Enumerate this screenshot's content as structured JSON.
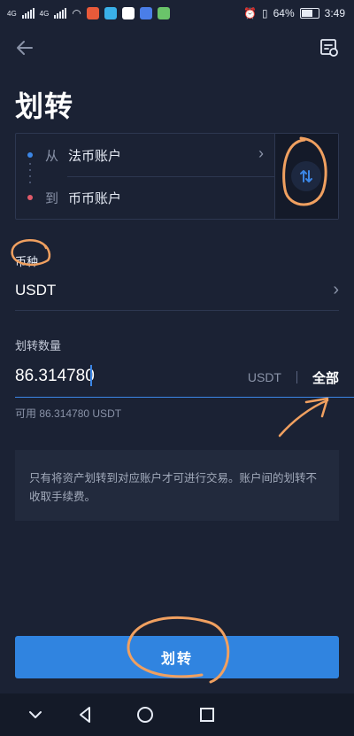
{
  "status_bar": {
    "network_left": "4G",
    "network_right": "4G",
    "battery": "64%",
    "time": "3:49"
  },
  "page": {
    "title": "划转"
  },
  "accounts": {
    "from_key": "从",
    "from_account": "法币账户",
    "to_key": "到",
    "to_account": "币币账户"
  },
  "coin": {
    "label": "币种",
    "value": "USDT"
  },
  "amount": {
    "label": "划转数量",
    "value": "86.314780",
    "unit": "USDT",
    "all_label": "全部"
  },
  "available": "可用 86.314780 USDT",
  "notice": "只有将资产划转到对应账户才可进行交易。账户间的划转不收取手续费。",
  "submit_label": "划转",
  "colors": {
    "background": "#1b2234",
    "accent": "#3084e0",
    "from_dot": "#3b86e6",
    "to_dot": "#e05a6a",
    "annotation": "#f0a060"
  },
  "icons": {
    "back": "arrow-left-icon",
    "record": "transfer-record-icon",
    "swap": "swap-arrows-icon",
    "chevron": "chevron-right-icon"
  }
}
